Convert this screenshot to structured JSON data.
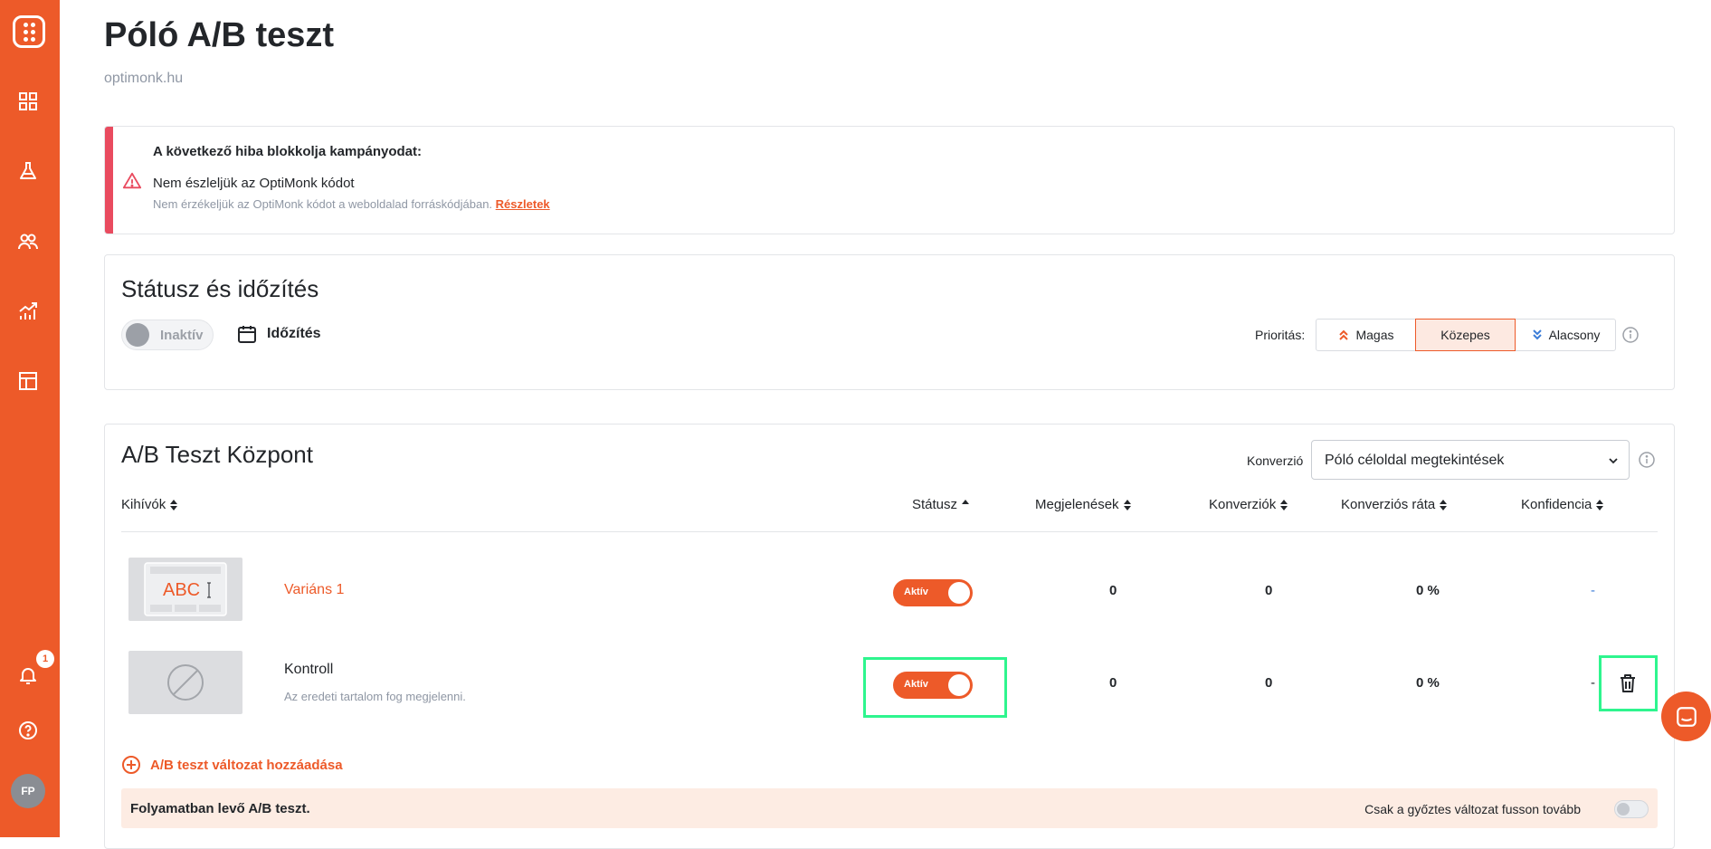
{
  "sidebar": {
    "notification_count": "1",
    "avatar_initials": "FP"
  },
  "page": {
    "title": "Póló A/B teszt",
    "subtitle": "optimonk.hu"
  },
  "alert": {
    "heading": "A következő hiba blokkolja kampányodat:",
    "title": "Nem észleljük az OptiMonk kódot",
    "description": "Nem érzékeljük az OptiMonk kódot a weboldalad forráskódjában.",
    "link": "Részletek"
  },
  "status_card": {
    "title": "Státusz és időzítés",
    "toggle_label": "Inaktív",
    "schedule_label": "Időzítés",
    "priority_label": "Prioritás:",
    "priority_options": [
      "Magas",
      "Közepes",
      "Alacsony"
    ],
    "priority_selected": "Közepes"
  },
  "ab_card": {
    "title": "A/B Teszt Központ",
    "conversion_label": "Konverzió",
    "conversion_value": "Póló céloldal megtekintések",
    "columns": {
      "challengers": "Kihívók",
      "status": "Státusz",
      "impressions": "Megjelenések",
      "conversions": "Konverziók",
      "conversion_rate": "Konverziós ráta",
      "confidence": "Konfidencia"
    },
    "rows": [
      {
        "name": "Variáns 1",
        "thumb_text": "ABC",
        "status": "Aktív",
        "impressions": "0",
        "conversions": "0",
        "conversion_rate": "0 %",
        "confidence": "-"
      },
      {
        "name": "Kontroll",
        "description": "Az eredeti tartalom fog megjelenni.",
        "status": "Aktív",
        "impressions": "0",
        "conversions": "0",
        "conversion_rate": "0 %",
        "confidence": "-"
      }
    ],
    "add_variant_label": "A/B teszt változat hozzáadása",
    "progress_text": "Folyamatban levő A/B teszt.",
    "winner_only_label": "Csak a győztes változat fusson tovább"
  },
  "colors": {
    "brand": "#ed5a29",
    "alert": "#e94b5f",
    "highlight": "#2ef58e"
  }
}
